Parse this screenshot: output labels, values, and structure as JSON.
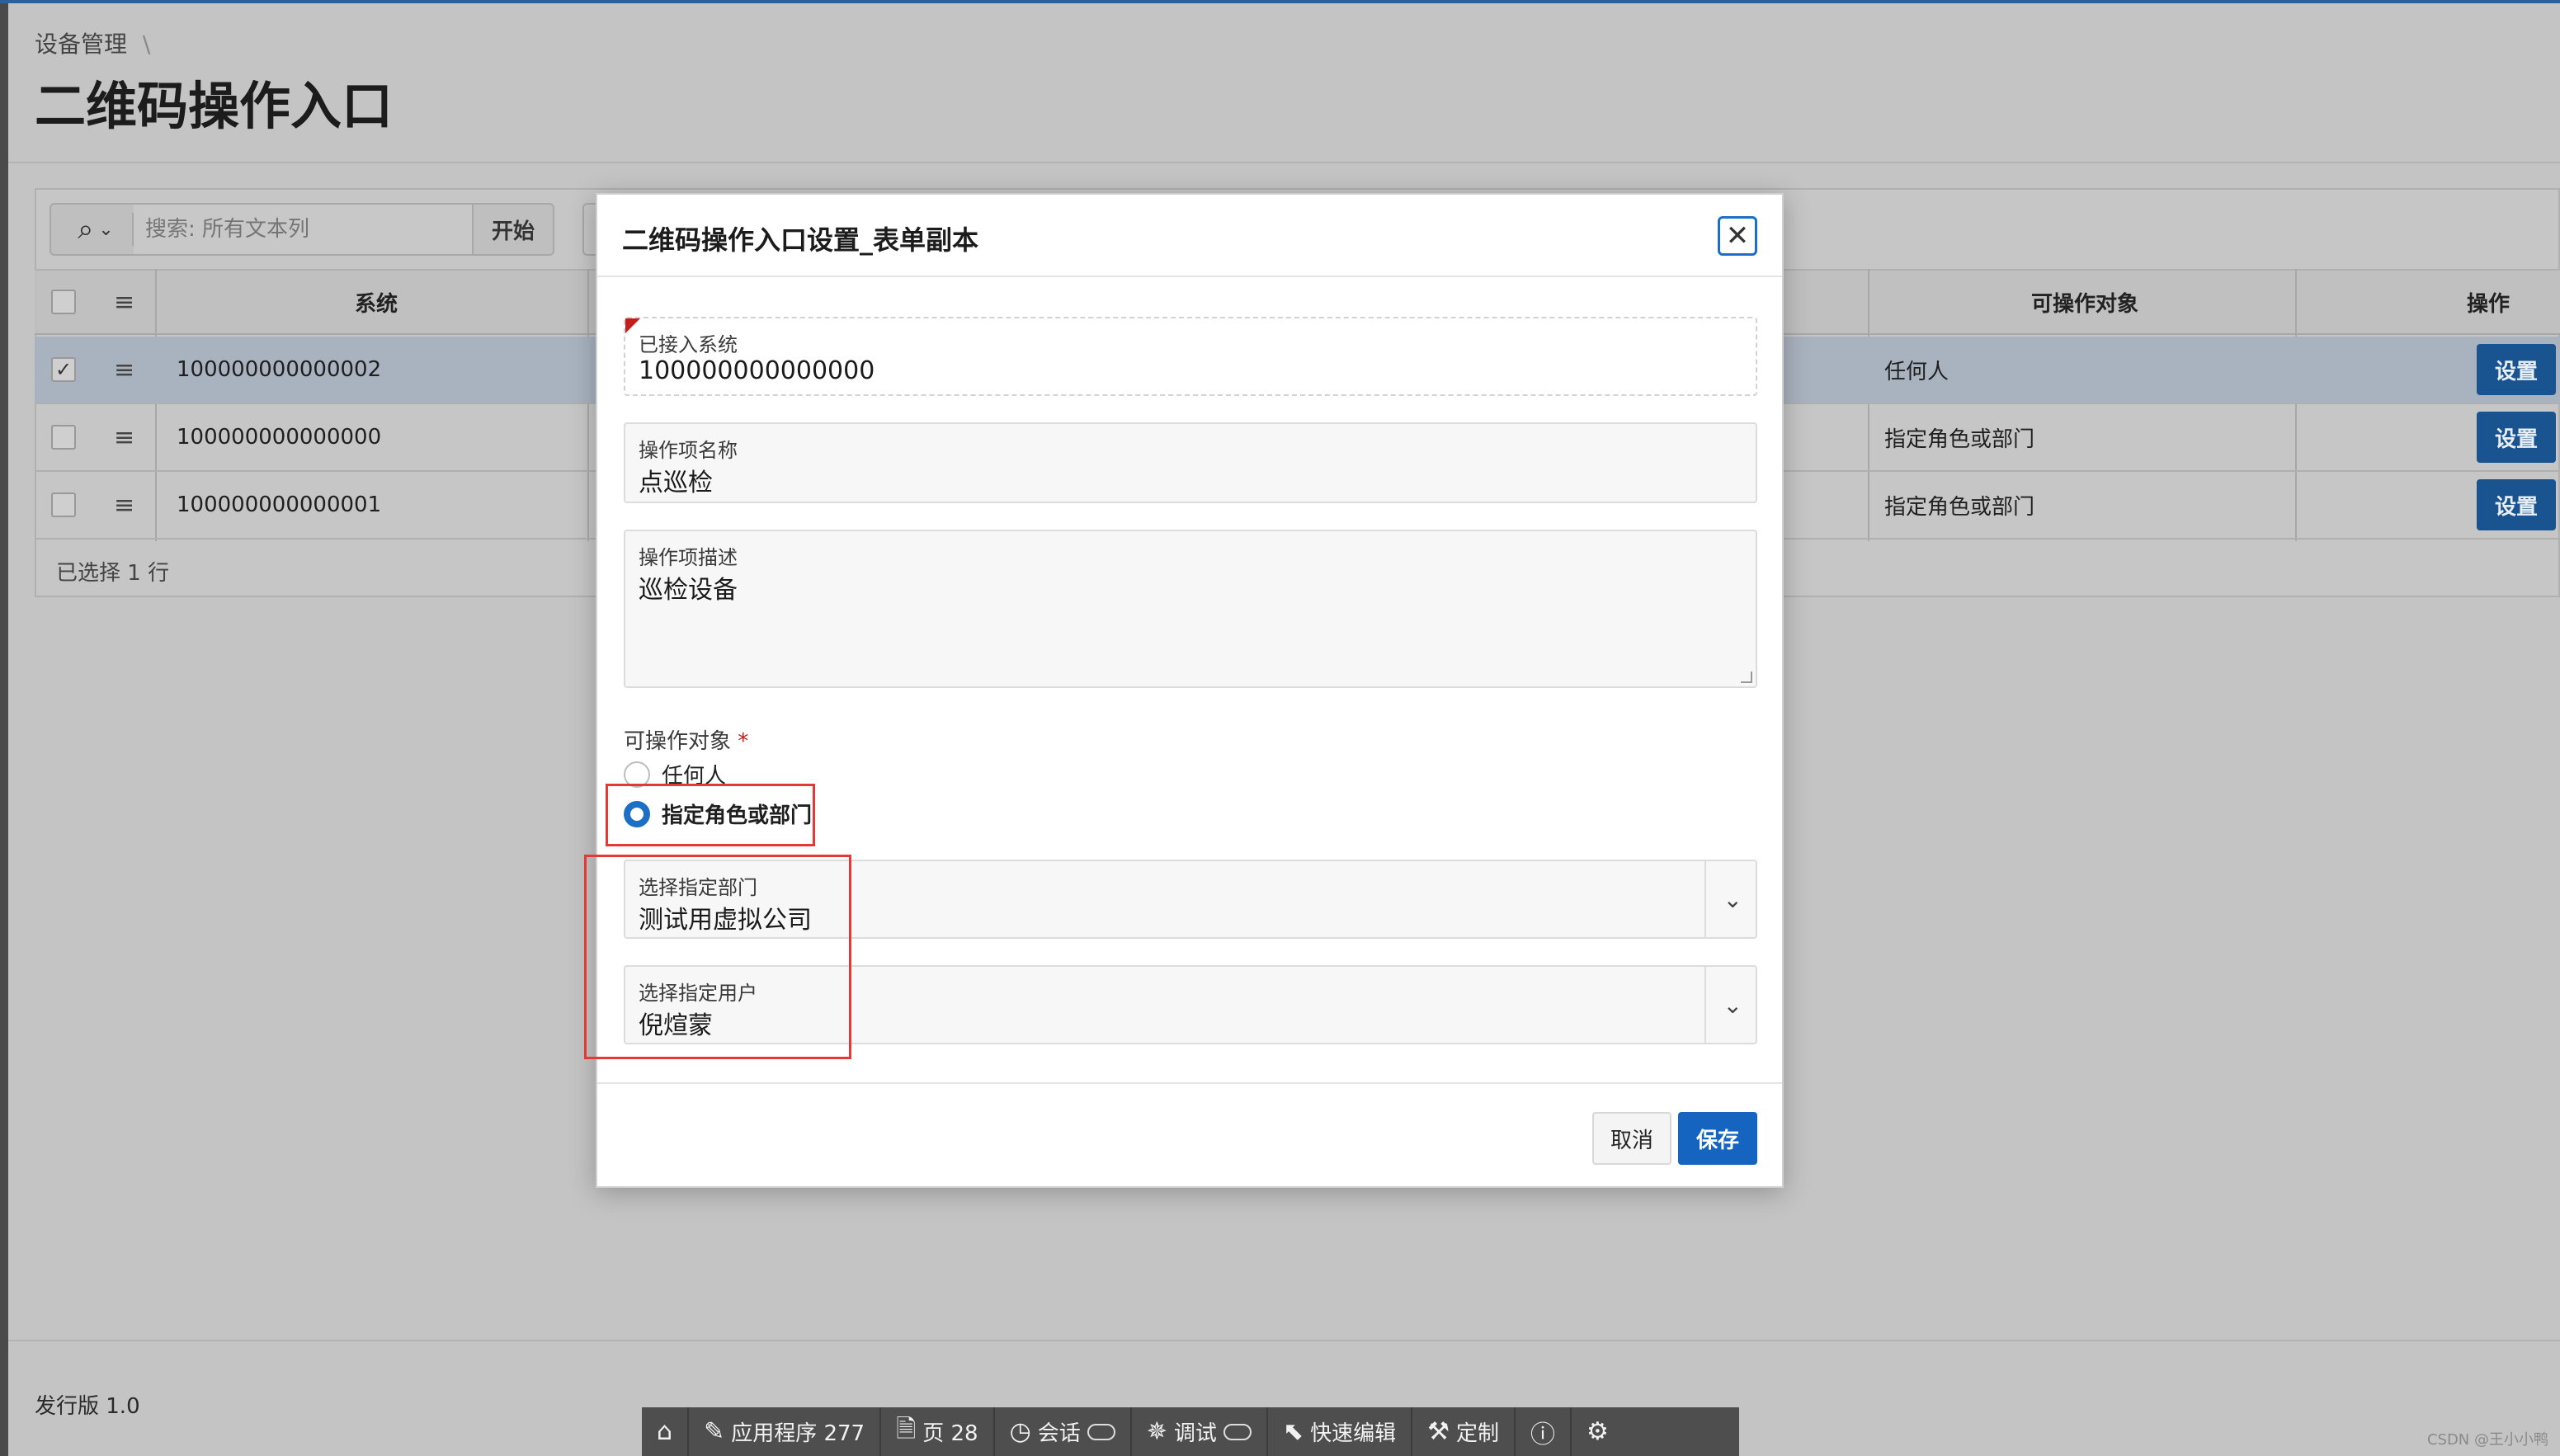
{
  "page": {
    "breadcrumb": "设备管理",
    "breadcrumb_sep": "\\",
    "title": "二维码操作入口"
  },
  "grid": {
    "search_placeholder": "搜索: 所有文本列",
    "go_label": "开始",
    "columns": {
      "system": "系统",
      "target": "可操作对象",
      "action": "操作"
    },
    "rows": [
      {
        "system": "100000000000002",
        "target": "任何人",
        "action": "设置",
        "selected": true
      },
      {
        "system": "100000000000000",
        "target": "指定角色或部门",
        "action": "设置",
        "selected": false
      },
      {
        "system": "100000000000001",
        "target": "指定角色或部门",
        "action": "设置",
        "selected": false
      }
    ],
    "footer": "已选择 1 行"
  },
  "footer": {
    "release": "发行版 1.0"
  },
  "devbar": {
    "items": [
      {
        "icon": "home-icon",
        "label": ""
      },
      {
        "icon": "edit-icon",
        "label": "应用程序 277"
      },
      {
        "icon": "page-icon",
        "label": "页 28"
      },
      {
        "icon": "session-icon",
        "label": "会话"
      },
      {
        "icon": "debug-icon",
        "label": "调试"
      },
      {
        "icon": "quick-edit-icon",
        "label": "快速编辑"
      },
      {
        "icon": "paint-roller-icon",
        "label": "定制"
      },
      {
        "icon": "info-icon",
        "label": ""
      },
      {
        "icon": "gear-icon",
        "label": ""
      }
    ]
  },
  "watermark": "CSDN @王小小鸭",
  "modal": {
    "title": "二维码操作入口设置_表单副本",
    "fields": {
      "system": {
        "label": "已接入系统",
        "value": "100000000000000"
      },
      "name": {
        "label": "操作项名称",
        "value": "点巡检"
      },
      "desc": {
        "label": "操作项描述",
        "value": "巡检设备"
      },
      "target_label": "可操作对象",
      "required_mark": "*",
      "options": [
        "任何人",
        "指定角色或部门"
      ],
      "selected_option": "指定角色或部门",
      "dept": {
        "label": "选择指定部门",
        "value": "测试用虚拟公司"
      },
      "user": {
        "label": "选择指定用户",
        "value": "倪煊蒙"
      }
    },
    "cancel_label": "取消",
    "save_label": "保存"
  },
  "colors": {
    "accent": "#1565c0",
    "annotation": "#e53935",
    "required": "#c41d1d"
  }
}
